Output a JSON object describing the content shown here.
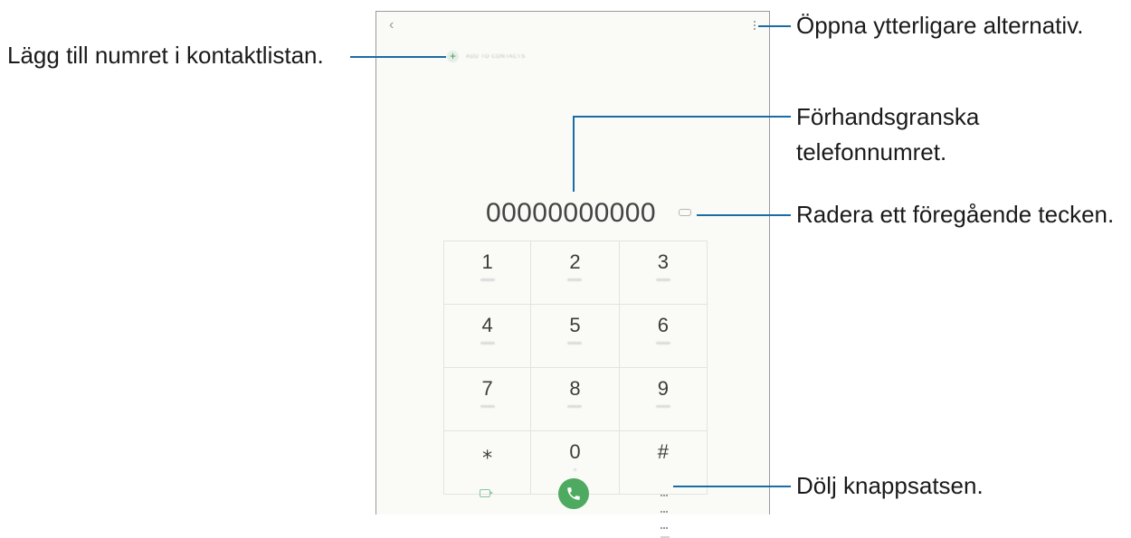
{
  "phone": {
    "back_glyph": "‹",
    "add_to_contacts": "ADD TO CONTACTS",
    "number": "00000000000",
    "keys": [
      {
        "digit": "1"
      },
      {
        "digit": "2"
      },
      {
        "digit": "3"
      },
      {
        "digit": "4"
      },
      {
        "digit": "5"
      },
      {
        "digit": "6"
      },
      {
        "digit": "7"
      },
      {
        "digit": "8"
      },
      {
        "digit": "9"
      },
      {
        "digit": "⁎"
      },
      {
        "digit": "0"
      },
      {
        "digit": "#"
      }
    ]
  },
  "annotations": {
    "add_contact": "Lägg till numret i kontaktlistan.",
    "more_options": "Öppna ytterligare alternativ.",
    "preview_line1": "Förhandsgranska",
    "preview_line2": "telefonnumret.",
    "delete_char": "Radera ett föregående tecken.",
    "hide_keypad": "Dölj knappsatsen."
  },
  "colors": {
    "callout_line": "#1b6ca5",
    "call_button": "#4faa61"
  },
  "icons": [
    "back-icon",
    "more-options-icon",
    "add-contact-icon",
    "backspace-icon",
    "video-call-icon",
    "call-icon",
    "keypad-icon"
  ]
}
